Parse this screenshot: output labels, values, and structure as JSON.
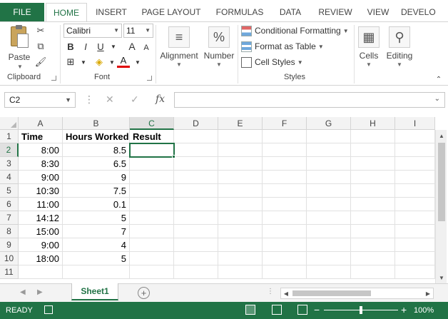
{
  "tabs": {
    "file": "FILE",
    "items": [
      "HOME",
      "INSERT",
      "PAGE LAYOUT",
      "FORMULAS",
      "DATA",
      "REVIEW",
      "VIEW",
      "DEVELO"
    ],
    "active": "HOME"
  },
  "ribbon": {
    "clipboard": {
      "label": "Clipboard",
      "paste": "Paste"
    },
    "font": {
      "label": "Font",
      "name": "Calibri",
      "size": "11",
      "bold": "B",
      "italic": "I",
      "underline": "U",
      "grow": "A",
      "shrink": "A",
      "font_color_glyph": "A"
    },
    "alignment": "Alignment",
    "number": "Number",
    "number_glyph": "%",
    "styles": {
      "label": "Styles",
      "conditional": "Conditional Formatting",
      "format_table": "Format as Table",
      "cell_styles": "Cell Styles"
    },
    "cells": "Cells",
    "editing": "Editing"
  },
  "formula_bar": {
    "name_box": "C2",
    "formula": "",
    "cancel_glyph": "✕",
    "enter_glyph": "✓",
    "fx_glyph": "fx"
  },
  "grid": {
    "columns": [
      "A",
      "B",
      "C",
      "D",
      "E",
      "F",
      "G",
      "H",
      "I"
    ],
    "rows": [
      "1",
      "2",
      "3",
      "4",
      "5",
      "6",
      "7",
      "8",
      "9",
      "10",
      "11"
    ],
    "header_row": {
      "a": "Time",
      "b": "Hours Worked",
      "c": "Result"
    },
    "data": [
      {
        "time": "8:00",
        "hours": "8.5"
      },
      {
        "time": "8:30",
        "hours": "6.5"
      },
      {
        "time": "9:00",
        "hours": "9"
      },
      {
        "time": "10:30",
        "hours": "7.5"
      },
      {
        "time": "11:00",
        "hours": "0.1"
      },
      {
        "time": "14:12",
        "hours": "5"
      },
      {
        "time": "15:00",
        "hours": "7"
      },
      {
        "time": "9:00",
        "hours": "4"
      },
      {
        "time": "18:00",
        "hours": "5"
      }
    ],
    "selected_column": "C",
    "selected_row": "2"
  },
  "sheets": {
    "active": "Sheet1",
    "add_glyph": "+"
  },
  "status": {
    "ready": "READY",
    "zoom_minus": "−",
    "zoom_plus": "+",
    "zoom": "100%"
  },
  "colors": {
    "accent": "#217346",
    "header_bg": "#f3f3f3",
    "gridline": "#e1e1e1"
  }
}
